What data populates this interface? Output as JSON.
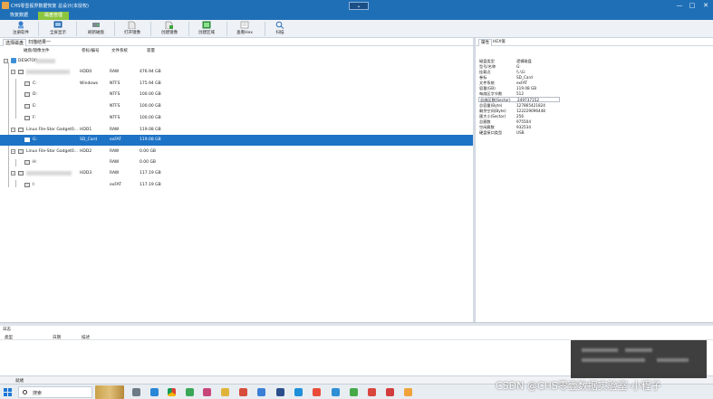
{
  "window": {
    "title": "CHS零壹视界数据恢复 总设计(本授权)",
    "collapse_glyph": "⌄",
    "minimize": "—",
    "maximize": "□",
    "close": "✕"
  },
  "ribbon_tabs": [
    {
      "label": "恢复数据",
      "active": false
    },
    {
      "label": "磁盘管理",
      "active": true
    }
  ],
  "toolbar": {
    "buttons": [
      {
        "label": "注册软件",
        "icon": "register-icon"
      },
      {
        "label": "全屏显示",
        "icon": "fullscreen-icon"
      },
      {
        "label": "刷新磁盘",
        "icon": "refresh-disk-icon"
      },
      {
        "label": "打开镜像",
        "icon": "open-image-icon"
      },
      {
        "label": "创建镜像",
        "icon": "create-image-icon"
      },
      {
        "label": "创建区域",
        "icon": "create-region-icon"
      },
      {
        "label": "查看Hex",
        "icon": "hex-icon"
      },
      {
        "label": "扫描",
        "icon": "scan-icon"
      }
    ]
  },
  "subtabs": [
    {
      "label": "选择磁盘",
      "active": true
    },
    {
      "label": "扫描结果一",
      "active": false
    }
  ],
  "disk_table": {
    "columns": [
      "磁盘/镜像文件",
      "卷标/编号",
      "文件系统",
      "容量"
    ],
    "rows": [
      {
        "name": "DESKTOP-",
        "label": "",
        "fs": "",
        "size": "",
        "level": 0,
        "kind": "pc"
      },
      {
        "name": "",
        "label": "HDD0",
        "fs": "RAW",
        "size": "476.94 GB",
        "level": 1,
        "kind": "disk"
      },
      {
        "name": "C:",
        "label": "Windows",
        "fs": "NTFS",
        "size": "175.94 GB",
        "level": 2,
        "kind": "vol"
      },
      {
        "name": "D:",
        "label": "",
        "fs": "NTFS",
        "size": "100.00 GB",
        "level": 2,
        "kind": "vol"
      },
      {
        "name": "E:",
        "label": "",
        "fs": "NTFS",
        "size": "100.00 GB",
        "level": 2,
        "kind": "vol"
      },
      {
        "name": "F:",
        "label": "",
        "fs": "NTFS",
        "size": "100.00 GB",
        "level": 2,
        "kind": "vol"
      },
      {
        "name": "Linux   File-Stor Gadget0...",
        "label": "HDD1",
        "fs": "RAW",
        "size": "119.08 GB",
        "level": 1,
        "kind": "disk"
      },
      {
        "name": "G:",
        "label": "SD_Card",
        "fs": "exFAT",
        "size": "119.08 GB",
        "level": 2,
        "kind": "vol",
        "selected": true
      },
      {
        "name": "Linux   File-Stor Gadget0...",
        "label": "HDD2",
        "fs": "RAW",
        "size": "0.00 GB",
        "level": 1,
        "kind": "disk"
      },
      {
        "name": "H:",
        "label": "",
        "fs": "RAW",
        "size": "0.00 GB",
        "level": 2,
        "kind": "vol"
      },
      {
        "name": "",
        "label": "HDD3",
        "fs": "RAW",
        "size": "117.19 GB",
        "level": 1,
        "kind": "disk"
      },
      {
        "name": "I:",
        "label": "",
        "fs": "exFAT",
        "size": "117.19 GB",
        "level": 2,
        "kind": "vol"
      }
    ]
  },
  "properties": {
    "tabs": [
      {
        "label": "属性",
        "active": true
      },
      {
        "label": "HEX值",
        "active": false
      }
    ],
    "rows": [
      {
        "k": "磁盘类型",
        "v": "逻辑磁盘"
      },
      {
        "k": "型号/名称",
        "v": "G:"
      },
      {
        "k": "挂载点",
        "v": "\\\\.\\G:"
      },
      {
        "k": "卷标",
        "v": "SD_Card"
      },
      {
        "k": "文件系统",
        "v": "exFAT"
      },
      {
        "k": "容量(GB)",
        "v": "119.08 GB"
      },
      {
        "k": "每扇区字节数",
        "v": "512"
      },
      {
        "k": "总扇区数(Sector)",
        "v": "249737152"
      },
      {
        "k": "总容量(Byte)",
        "v": "127865421824"
      },
      {
        "k": "剩余空间(Byte)",
        "v": "122229096448"
      },
      {
        "k": "簇大小(Sector)",
        "v": "256"
      },
      {
        "k": "总簇数",
        "v": "975504"
      },
      {
        "k": "空闲簇数",
        "v": "932534"
      },
      {
        "k": "硬盘接口类型",
        "v": "USB"
      }
    ]
  },
  "log": {
    "title": "日志",
    "columns": [
      "类型",
      "日期",
      "描述"
    ]
  },
  "status": {
    "text": "就绪"
  },
  "taskbar": {
    "search_placeholder": "搜索",
    "icons": [
      "task-view-icon",
      "edge-icon",
      "chrome-icon",
      "app-icon",
      "app-icon",
      "app-icon",
      "app-icon",
      "app-icon",
      "app-icon",
      "app-icon",
      "app-icon",
      "app-icon",
      "app-icon",
      "app-icon",
      "app-icon",
      "app-icon",
      "app-icon",
      "app-icon",
      "app-icon",
      "app-icon"
    ]
  },
  "watermark": "CSDN @CHS零壹数据实验室-小程子"
}
